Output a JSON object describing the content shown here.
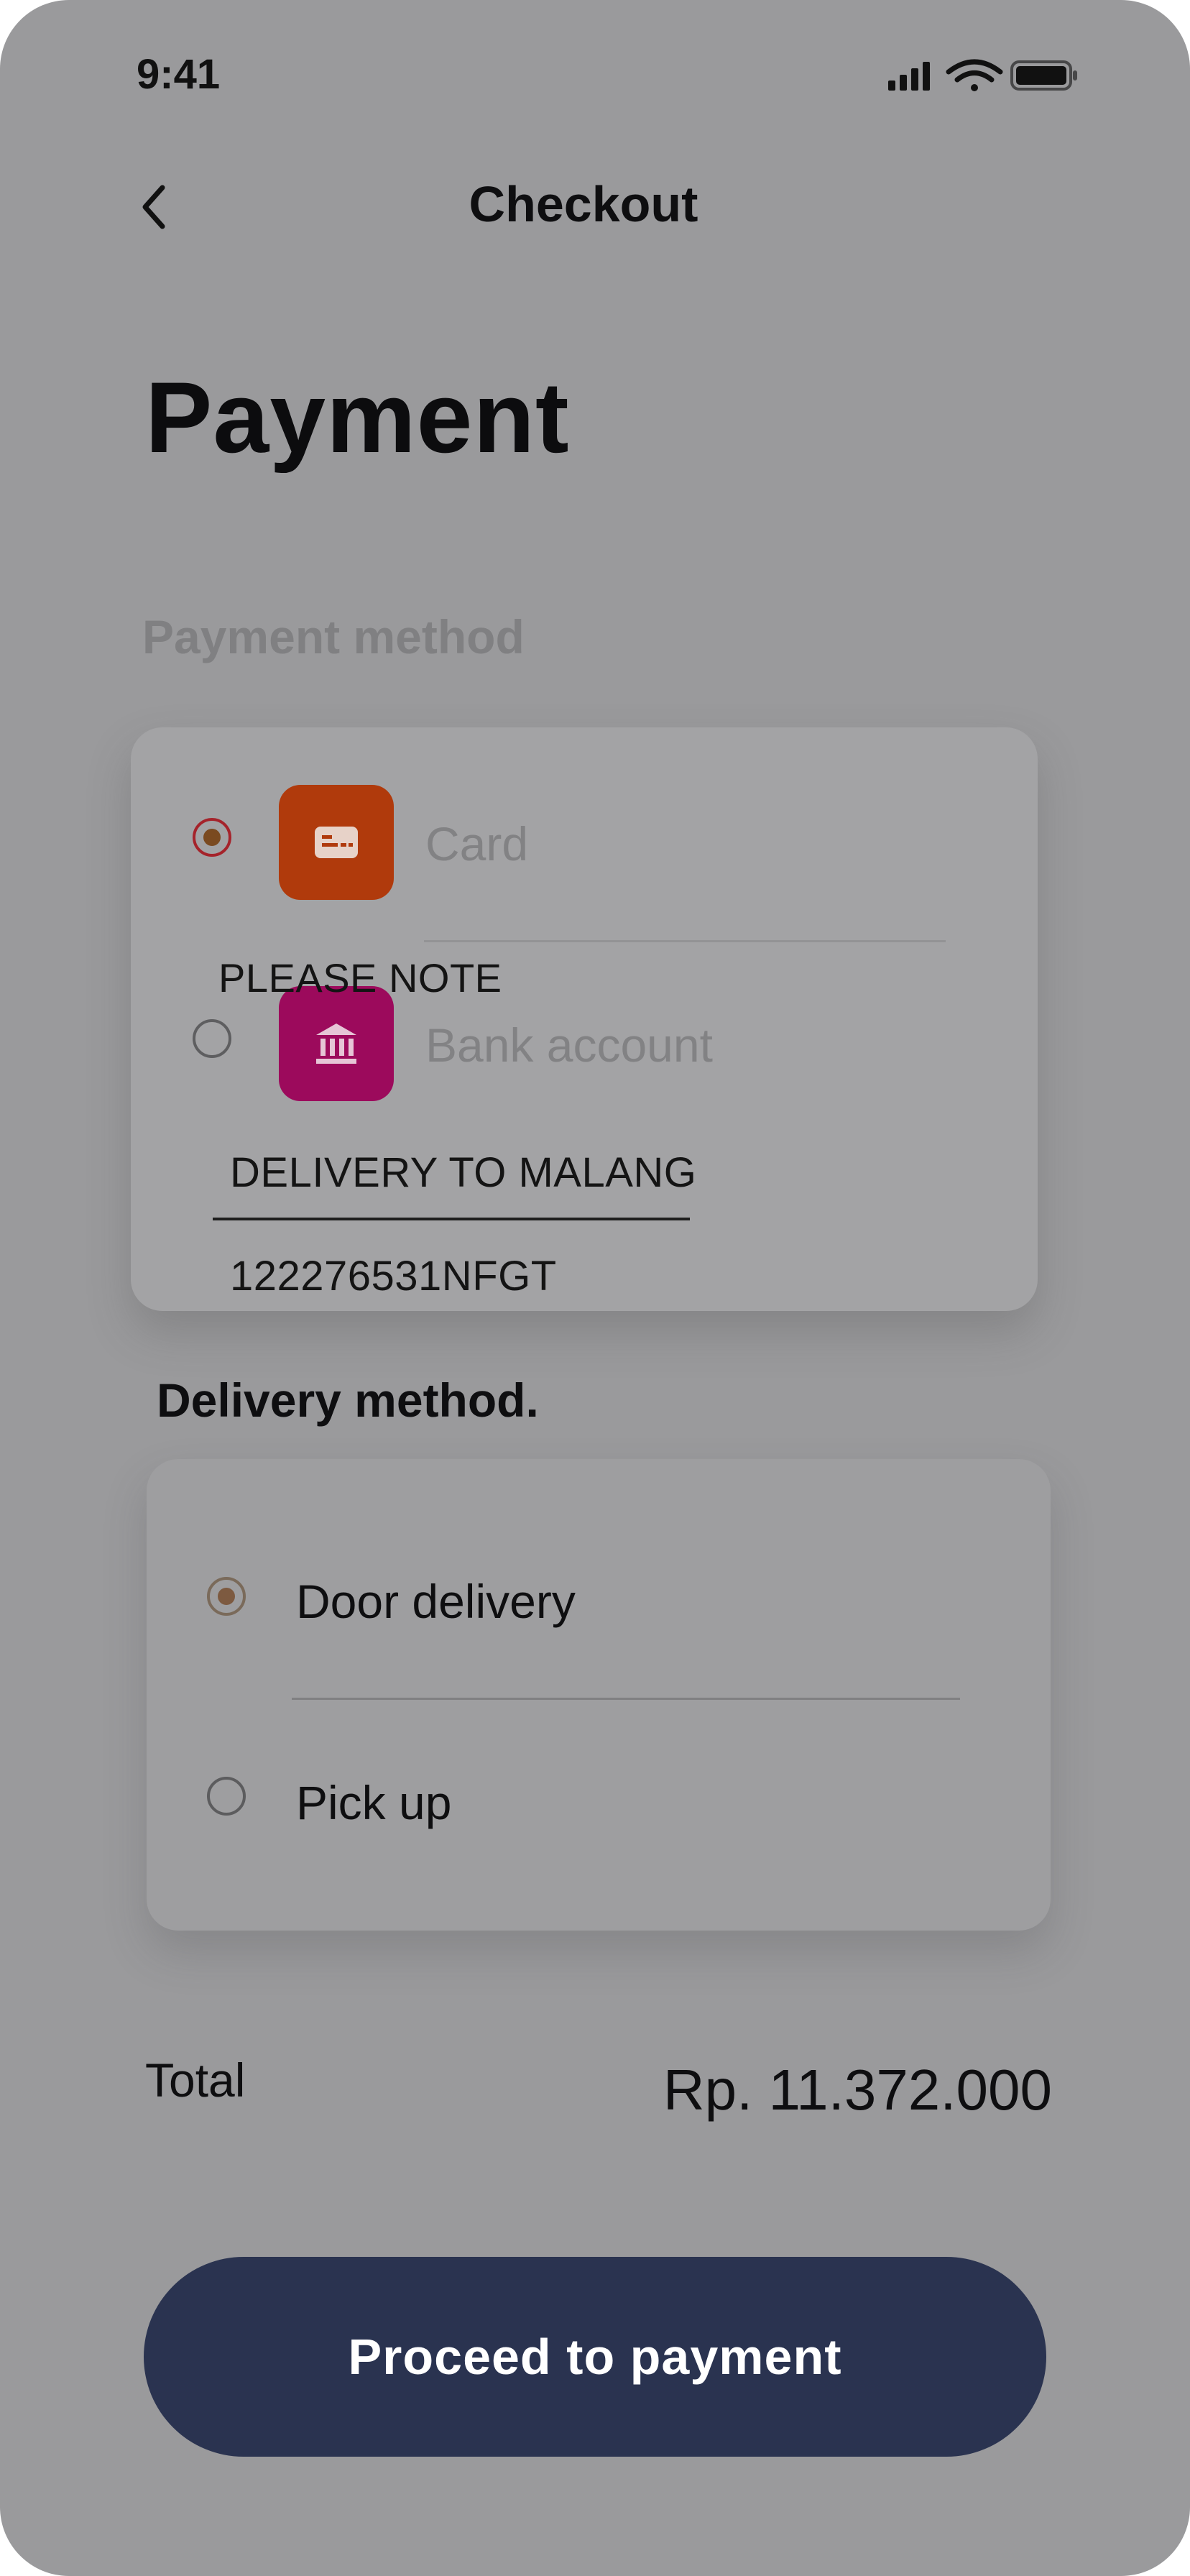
{
  "status_bar": {
    "time": "9:41"
  },
  "nav": {
    "title": "Checkout"
  },
  "page_title": "Payment",
  "payment": {
    "section_label": "Payment method",
    "methods": [
      {
        "label": "Card",
        "selected": true,
        "icon": "credit-card-icon",
        "color": "#b03a0c"
      },
      {
        "label": "Bank account",
        "selected": false,
        "icon": "bank-icon",
        "color": "#9c0a5c"
      }
    ]
  },
  "note": {
    "label": "PLEASE NOTE",
    "value": "DELIVERY TO MALANG",
    "code": "122276531NFGT"
  },
  "delivery": {
    "section_label": "Delivery method.",
    "options": [
      {
        "label": "Door delivery",
        "selected": true
      },
      {
        "label": "Pick up",
        "selected": false
      }
    ]
  },
  "summary": {
    "total_label": "Total",
    "total_value": "Rp. 11.372.000"
  },
  "cta": {
    "label": "Proceed to payment",
    "color": "#2a3350"
  }
}
